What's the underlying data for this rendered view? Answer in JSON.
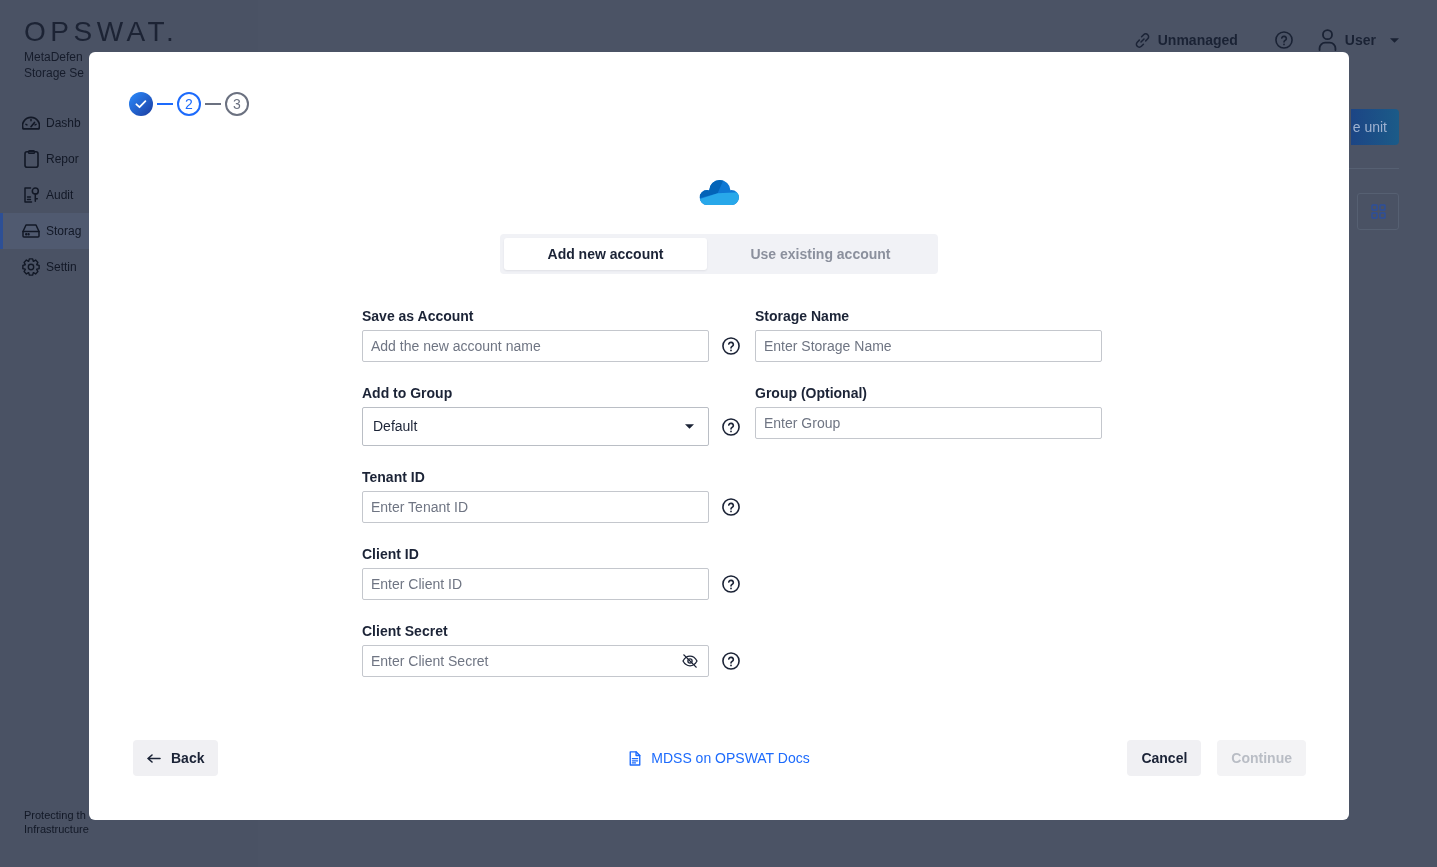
{
  "app": {
    "logo": "OPSWAT.",
    "product": [
      "MetaDefen",
      "Storage Se"
    ],
    "nav": [
      {
        "label": "Dashb",
        "selected": false
      },
      {
        "label": "Repor",
        "selected": false
      },
      {
        "label": "Audit",
        "selected": false
      },
      {
        "label": "Storag",
        "selected": true
      },
      {
        "label": "Settin",
        "selected": false
      }
    ],
    "tagline": [
      "Protecting th",
      "Infrastructure"
    ],
    "header": {
      "status": "Unmanaged",
      "user": "User"
    },
    "action_button": "e unit"
  },
  "dialog": {
    "steps": [
      {
        "completed": true,
        "selected": false
      },
      {
        "label": "2",
        "completed": false,
        "selected": true
      },
      {
        "label": "3",
        "completed": false,
        "selected": false
      }
    ],
    "tabs": [
      {
        "label": "Add new account",
        "selected": true
      },
      {
        "label": "Use existing account",
        "selected": false
      }
    ],
    "form": {
      "rows": [
        {
          "fields": [
            {
              "kind": "text",
              "label": "Save as Account",
              "placeholder": "Add the new account name",
              "help": true
            },
            {
              "kind": "text",
              "label": "Storage Name",
              "placeholder": "Enter Storage Name",
              "help": false
            }
          ]
        },
        {
          "fields": [
            {
              "kind": "select",
              "label": "Add to Group",
              "value": "Default",
              "help": true
            },
            {
              "kind": "text",
              "label": "Group (Optional)",
              "placeholder": "Enter Group",
              "help": false
            }
          ]
        },
        {
          "fields": [
            {
              "kind": "text",
              "label": "Tenant ID",
              "placeholder": "Enter Tenant ID",
              "help": true
            }
          ]
        },
        {
          "fields": [
            {
              "kind": "text",
              "label": "Client ID",
              "placeholder": "Enter Client ID",
              "help": true
            }
          ]
        },
        {
          "fields": [
            {
              "kind": "password",
              "label": "Client Secret",
              "placeholder": "Enter Client Secret",
              "revealed": false,
              "help": true
            }
          ]
        }
      ]
    },
    "back_button": "Back",
    "docs_link": "MDSS on OPSWAT Docs",
    "buttons": [
      {
        "label": "Cancel",
        "disabled": false
      },
      {
        "label": "Continue",
        "disabled": true
      }
    ]
  }
}
